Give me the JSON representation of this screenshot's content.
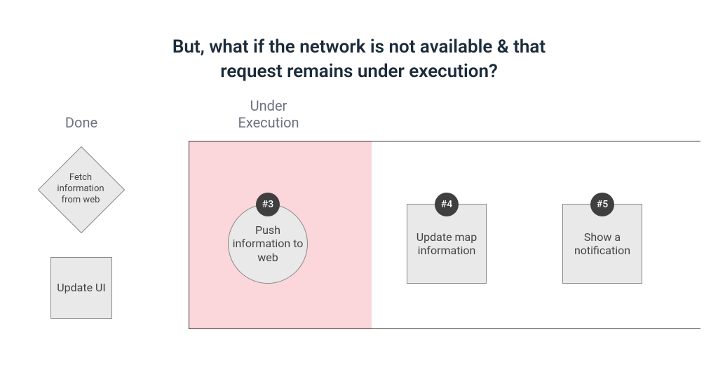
{
  "title_line1": "But, what if the network is not available & that",
  "title_line2": "request remains under execution?",
  "done_label": "Done",
  "under_label_line1": "Under",
  "under_label_line2": "Execution",
  "done_items": {
    "diamond": "Fetch information from web",
    "box": "Update UI"
  },
  "queue": [
    {
      "badge": "#3",
      "label": "Push information to web",
      "shape": "circle",
      "highlighted": true
    },
    {
      "badge": "#4",
      "label": "Update map information",
      "shape": "square",
      "highlighted": false
    },
    {
      "badge": "#5",
      "label": "Show a notification",
      "shape": "square",
      "highlighted": false
    }
  ]
}
